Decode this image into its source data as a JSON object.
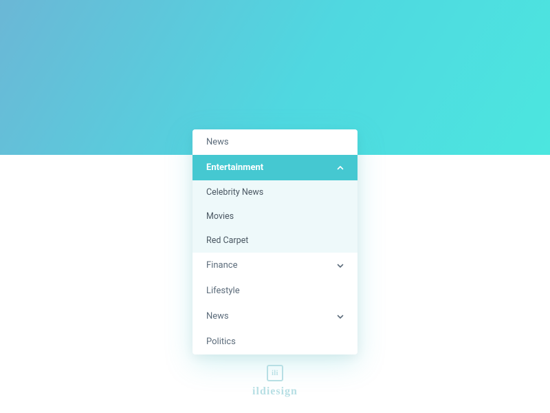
{
  "menu": {
    "items": [
      {
        "label": "News",
        "type": "normal"
      },
      {
        "label": "Entertainment",
        "type": "active",
        "chevron": "up"
      },
      {
        "label": "Celebrity News",
        "type": "sub"
      },
      {
        "label": "Movies",
        "type": "sub"
      },
      {
        "label": "Red Carpet",
        "type": "sub"
      },
      {
        "label": "Finance",
        "type": "normal",
        "chevron": "down"
      },
      {
        "label": "Lifestyle",
        "type": "normal"
      },
      {
        "label": "News",
        "type": "normal",
        "chevron": "down"
      },
      {
        "label": "Politics",
        "type": "normal"
      }
    ]
  },
  "brand": {
    "mark": "ili",
    "name": "ildiesign"
  },
  "colors": {
    "accent": "#45c8d1",
    "text": "#5b6b7a",
    "subBg": "#eef9fa",
    "brand": "#b7dfe4"
  }
}
